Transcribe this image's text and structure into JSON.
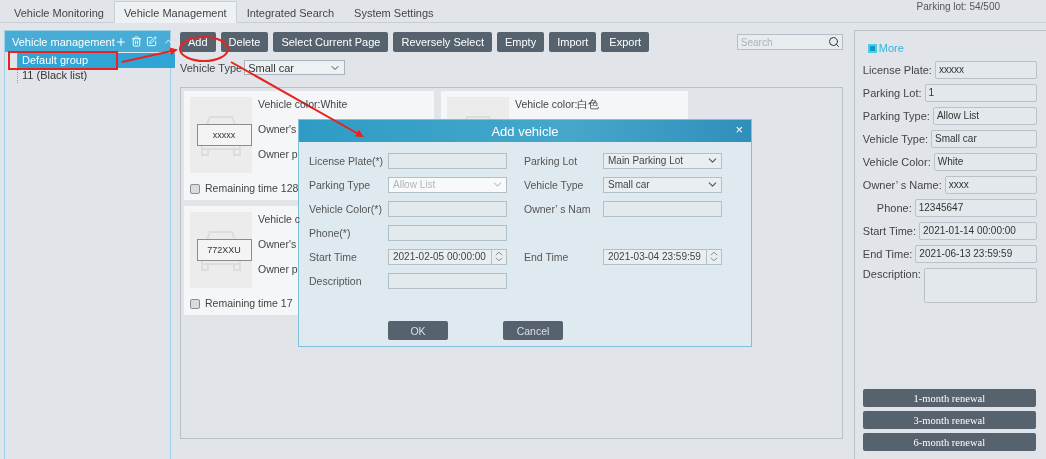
{
  "tabs": [
    {
      "label": "Vehicle Monitoring",
      "selected": false
    },
    {
      "label": "Vehicle Management",
      "selected": true
    },
    {
      "label": "Integrated Search",
      "selected": false
    },
    {
      "label": "System Settings",
      "selected": false
    }
  ],
  "parking_lot_status": "Parking lot: 54/500",
  "sidebar": {
    "title": "Vehicle management",
    "groups": [
      {
        "label": "Default group",
        "selected": true
      },
      {
        "label": "11 (Black list)",
        "selected": false
      }
    ]
  },
  "toolbar": {
    "buttons": [
      "Add",
      "Delete",
      "Select Current Page",
      "Reversely Select",
      "Empty",
      "Import",
      "Export"
    ],
    "search": {
      "placeholder": "Search"
    }
  },
  "filter": {
    "label": "Vehicle Type",
    "value": "Small car"
  },
  "cards": [
    {
      "plate": "xxxxx",
      "lines": [
        "Vehicle color:White",
        "Owner's",
        "Owner p"
      ],
      "remaining": "Remaining time 128",
      "checked": false
    },
    {
      "lines": [
        "Vehicle color:白色"
      ]
    },
    {
      "plate": "772XXU",
      "lines": [
        "Vehicle c",
        "Owner's",
        "Owner p"
      ],
      "remaining": "Remaining time 17",
      "checked": false
    }
  ],
  "dialog": {
    "title": "Add vehicle",
    "close": "×",
    "rows": [
      [
        {
          "label": "License Plate(*)",
          "kind": "text",
          "disabled": false
        },
        {
          "label": "Parking Lot",
          "kind": "select",
          "value": "Main Parking Lot",
          "disabled": false
        }
      ],
      [
        {
          "label": "Parking Type",
          "kind": "select",
          "value": "Allow List",
          "disabled": true
        },
        {
          "label": "Vehicle Type",
          "kind": "select",
          "value": "Small car",
          "disabled": false
        }
      ],
      [
        {
          "label": "Vehicle Color(*)",
          "kind": "text",
          "disabled": false
        },
        {
          "label": "Owner’ s Nam",
          "kind": "text",
          "disabled": false
        }
      ],
      [
        {
          "label": "Phone(*)",
          "kind": "text",
          "disabled": false
        }
      ],
      [
        {
          "label": "Start Time",
          "kind": "datetime",
          "value": "2021-02-05 00:00:00",
          "disabled": false
        },
        {
          "label": "End Time",
          "kind": "datetime",
          "value": "2021-03-04 23:59:59",
          "disabled": false
        }
      ],
      [
        {
          "label": "Description",
          "kind": "text",
          "disabled": false
        }
      ]
    ],
    "buttons": [
      "OK",
      "Cancel"
    ]
  },
  "right_panel": {
    "more": {
      "label": "More",
      "checked": true
    },
    "details": [
      {
        "label": "License Plate:",
        "value": "xxxxx"
      },
      {
        "label": "Parking Lot:",
        "value": "1"
      },
      {
        "label": "Parking Type:",
        "value": "Allow List"
      },
      {
        "label": "Vehicle Type:",
        "value": "Small car"
      },
      {
        "label": "Vehicle Color:",
        "value": "White"
      },
      {
        "label": "Owner’ s Name:",
        "value": "xxxx"
      },
      {
        "label": "Phone:",
        "value": "12345647"
      },
      {
        "label": "Start Time:",
        "value": "2021-01-14 00:00:00"
      },
      {
        "label": "End Time:",
        "value": "2021-06-13 23:59:59"
      },
      {
        "label": "Description:",
        "kind": "textarea"
      }
    ],
    "renewal_buttons": [
      "1-month renewal",
      "3-month renewal",
      "6-month renewal"
    ]
  }
}
